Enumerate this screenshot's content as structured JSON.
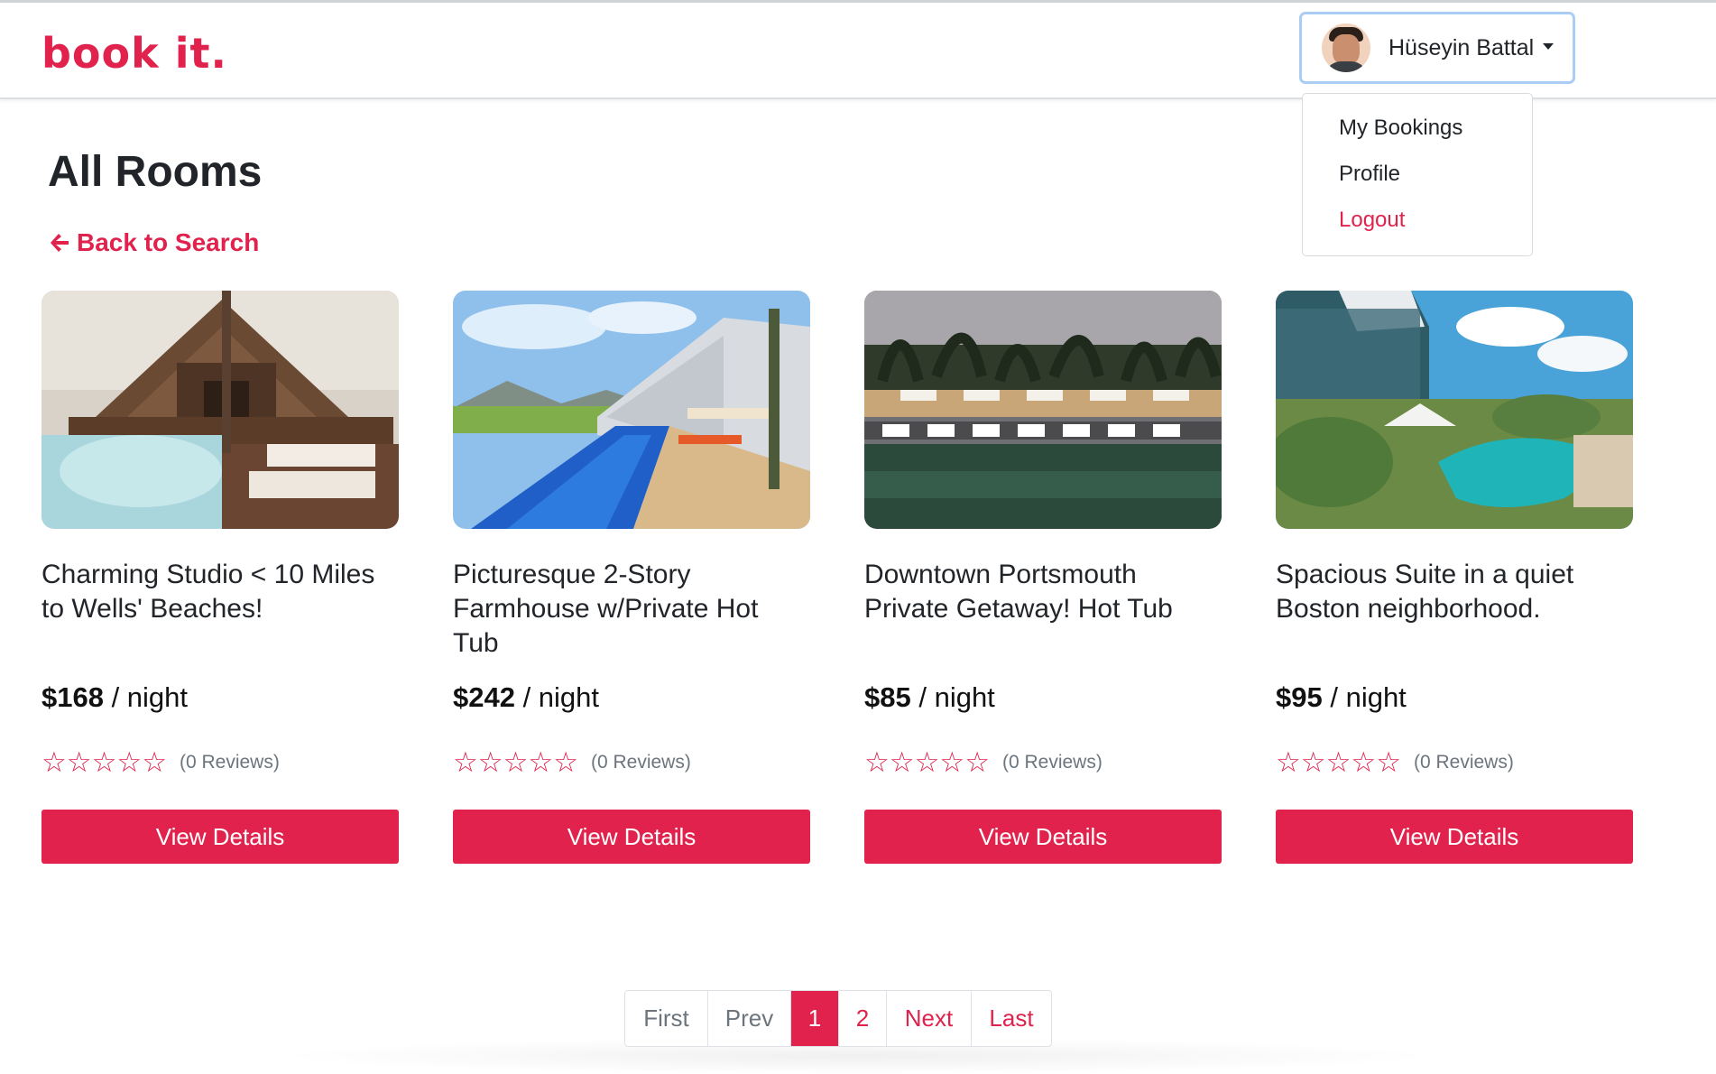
{
  "header": {
    "logo_text": "book it.",
    "user_name": "Hüseyin Battal"
  },
  "user_menu": {
    "items": [
      "My Bookings",
      "Profile",
      "Logout"
    ]
  },
  "main": {
    "title": "All Rooms",
    "back_link": "Back to Search"
  },
  "rooms": [
    {
      "title": "Charming Studio < 10 Miles to Wells' Beaches!",
      "price": "$168",
      "per": " / night",
      "reviews": "(0 Reviews)",
      "rating": 0,
      "button": "View Details"
    },
    {
      "title": "Picturesque 2-Story Farmhouse w/Private Hot Tub",
      "price": "$242",
      "per": " / night",
      "reviews": "(0 Reviews)",
      "rating": 0,
      "button": "View Details"
    },
    {
      "title": "Downtown Portsmouth Private Getaway! Hot Tub",
      "price": "$85",
      "per": " / night",
      "reviews": "(0 Reviews)",
      "rating": 0,
      "button": "View Details"
    },
    {
      "title": "Spacious Suite in a quiet Boston neighborhood.",
      "price": "$95",
      "per": " / night",
      "reviews": "(0 Reviews)",
      "rating": 0,
      "button": "View Details"
    }
  ],
  "pagination": {
    "first": "First",
    "prev": "Prev",
    "page1": "1",
    "page2": "2",
    "next": "Next",
    "last": "Last"
  },
  "colors": {
    "brand": "#e0224d",
    "focus_ring": "#a9cdf5"
  }
}
